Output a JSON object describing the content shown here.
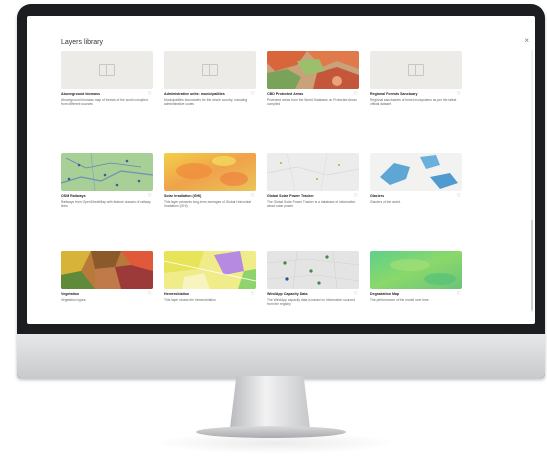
{
  "panel": {
    "title": "Layers library"
  },
  "icons": {
    "close": "close-icon",
    "heart": "heart-icon",
    "placeholder": "book-icon"
  },
  "colors": {
    "bezel": "#1c1d20",
    "chin": "#d9dadc",
    "screen": "#ffffff"
  },
  "cards": [
    {
      "name": "Aboveground biomass",
      "desc": "Aboveground biomass map of forests of the world compiled from different sources"
    },
    {
      "name": "Administrative units: municipalities",
      "desc": "Municipalities boundaries for the whole country, including administrative codes"
    },
    {
      "name": "CBD Protected Areas",
      "desc": "Protected areas from the World Database on Protected Areas compiled"
    },
    {
      "name": "Regional Forests Sanctuary",
      "desc": "Regional sanctuaries of forest ecosystems as per the latest official dataset"
    },
    {
      "name": "OSM Railways",
      "desc": "Railways from OpenStreetMap with feature classes of railway lines"
    },
    {
      "name": "Solar Irradiation (GHI)",
      "desc": "This layer presents long-term averages of Global Horizontal Irradiation (GHI)"
    },
    {
      "name": "Global Solar Power Tracker",
      "desc": "The Global Solar Power Tracker is a database of information about solar power"
    },
    {
      "name": "Glaciers",
      "desc": "Glaciers of the world."
    },
    {
      "name": "Vegetation",
      "desc": "Vegetation types."
    },
    {
      "name": "Hemerobiation",
      "desc": "This layer shows the hemerobiation"
    },
    {
      "name": "WindApp Capacity Data",
      "desc": "The WindApp capacity data is based on information sourced from the registry"
    },
    {
      "name": "Degradation Map",
      "desc": "The performance of the model over time."
    }
  ]
}
